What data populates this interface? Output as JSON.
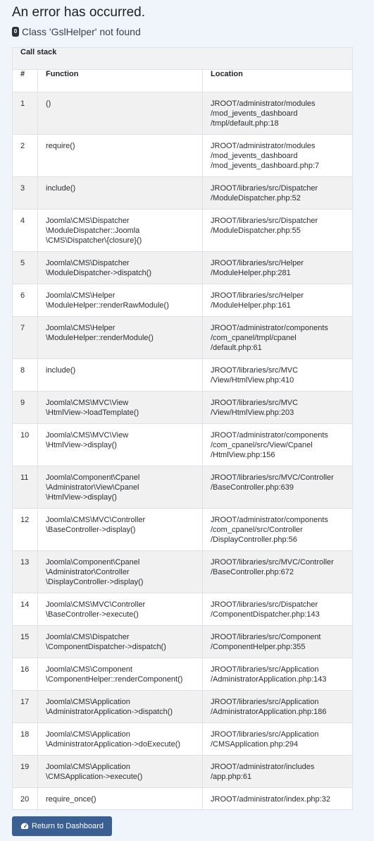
{
  "error": {
    "title": "An error has occurred.",
    "code": "0",
    "message": "Class 'GslHelper' not found"
  },
  "callstack": {
    "caption": "Call stack",
    "headers": {
      "num": "#",
      "function": "Function",
      "location": "Location"
    },
    "rows": [
      {
        "num": "1",
        "fn": [
          "()"
        ],
        "loc": [
          "JROOT/administrator/modules",
          "/mod_jevents_dashboard",
          "/tmpl/default.php:18"
        ],
        "h": 60
      },
      {
        "num": "2",
        "fn": [
          "require()"
        ],
        "loc": [
          "JROOT/administrator/modules",
          "/mod_jevents_dashboard",
          "/mod_jevents_dashboard.php:7"
        ],
        "h": 60
      },
      {
        "num": "3",
        "fn": [
          "include()"
        ],
        "loc": [
          "JROOT/libraries/src/Dispatcher",
          "/ModuleDispatcher.php:52"
        ],
        "h": 46
      },
      {
        "num": "4",
        "fn": [
          "Joomla\\CMS\\Dispatcher",
          "\\ModuleDispatcher::Joomla",
          "\\CMS\\Dispatcher\\{closure}()"
        ],
        "loc": [
          "JROOT/libraries/src/Dispatcher",
          "/ModuleDispatcher.php:55"
        ],
        "h": 60
      },
      {
        "num": "5",
        "fn": [
          "Joomla\\CMS\\Dispatcher",
          "\\ModuleDispatcher->dispatch()"
        ],
        "loc": [
          "JROOT/libraries/src/Helper",
          "/ModuleHelper.php:281"
        ],
        "h": 46
      },
      {
        "num": "6",
        "fn": [
          "Joomla\\CMS\\Helper",
          "\\ModuleHelper::renderRawModule()"
        ],
        "loc": [
          "JROOT/libraries/src/Helper",
          "/ModuleHelper.php:161"
        ],
        "h": 46
      },
      {
        "num": "7",
        "fn": [
          "Joomla\\CMS\\Helper",
          "\\ModuleHelper::renderModule()"
        ],
        "loc": [
          "JROOT/administrator/components",
          "/com_cpanel/tmpl/cpanel",
          "/default.php:61"
        ],
        "h": 60
      },
      {
        "num": "8",
        "fn": [
          "include()"
        ],
        "loc": [
          "JROOT/libraries/src/MVC",
          "/View/HtmlView.php:410"
        ],
        "h": 46
      },
      {
        "num": "9",
        "fn": [
          "Joomla\\CMS\\MVC\\View",
          "\\HtmlView->loadTemplate()"
        ],
        "loc": [
          "JROOT/libraries/src/MVC",
          "/View/HtmlView.php:203"
        ],
        "h": 46
      },
      {
        "num": "10",
        "fn": [
          "Joomla\\CMS\\MVC\\View",
          "\\HtmlView->display()"
        ],
        "loc": [
          "JROOT/administrator/components",
          "/com_cpanel/src/View/Cpanel",
          "/HtmlView.php:156"
        ],
        "h": 60
      },
      {
        "num": "11",
        "fn": [
          "Joomla\\Component\\Cpanel",
          "\\Administrator\\View\\Cpanel",
          "\\HtmlView->display()"
        ],
        "loc": [
          "JROOT/libraries/src/MVC/Controller",
          "/BaseController.php:639"
        ],
        "h": 60
      },
      {
        "num": "12",
        "fn": [
          "Joomla\\CMS\\MVC\\Controller",
          "\\BaseController->display()"
        ],
        "loc": [
          "JROOT/administrator/components",
          "/com_cpanel/src/Controller",
          "/DisplayController.php:56"
        ],
        "h": 60
      },
      {
        "num": "13",
        "fn": [
          "Joomla\\Component\\Cpanel",
          "\\Administrator\\Controller",
          "\\DisplayController->display()"
        ],
        "loc": [
          "JROOT/libraries/src/MVC/Controller",
          "/BaseController.php:672"
        ],
        "h": 60
      },
      {
        "num": "14",
        "fn": [
          "Joomla\\CMS\\MVC\\Controller",
          "\\BaseController->execute()"
        ],
        "loc": [
          "JROOT/libraries/src/Dispatcher",
          "/ComponentDispatcher.php:143"
        ],
        "h": 46
      },
      {
        "num": "15",
        "fn": [
          "Joomla\\CMS\\Dispatcher",
          "\\ComponentDispatcher->dispatch()"
        ],
        "loc": [
          "JROOT/libraries/src/Component",
          "/ComponentHelper.php:355"
        ],
        "h": 46
      },
      {
        "num": "16",
        "fn": [
          "Joomla\\CMS\\Component",
          "\\ComponentHelper::renderComponent()"
        ],
        "loc": [
          "JROOT/libraries/src/Application",
          "/AdministratorApplication.php:143"
        ],
        "h": 46
      },
      {
        "num": "17",
        "fn": [
          "Joomla\\CMS\\Application",
          "\\AdministratorApplication->dispatch()"
        ],
        "loc": [
          "JROOT/libraries/src/Application",
          "/AdministratorApplication.php:186"
        ],
        "h": 46
      },
      {
        "num": "18",
        "fn": [
          "Joomla\\CMS\\Application",
          "\\AdministratorApplication->doExecute()"
        ],
        "loc": [
          "JROOT/libraries/src/Application",
          "/CMSApplication.php:294"
        ],
        "h": 46
      },
      {
        "num": "19",
        "fn": [
          "Joomla\\CMS\\Application",
          "\\CMSApplication->execute()"
        ],
        "loc": [
          "JROOT/administrator/includes",
          "/app.php:61"
        ],
        "h": 46
      },
      {
        "num": "20",
        "fn": [
          "require_once()"
        ],
        "loc": [
          "JROOT/administrator/index.php:32"
        ],
        "h": 31
      }
    ]
  },
  "return_button": {
    "label": "Return to Dashboard",
    "icon": "dashboard-gauge-icon"
  }
}
